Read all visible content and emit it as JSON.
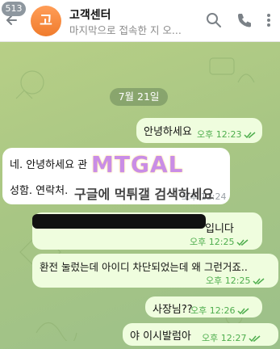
{
  "header": {
    "badge": "513",
    "avatar_letter": "고",
    "title": "고객센터",
    "subtitle": "마지막으로 접속한 지 오...",
    "icons": [
      "back-arrow-icon",
      "search-icon",
      "phone-icon",
      "more-vertical-icon"
    ]
  },
  "date_pill": "7월 21일",
  "messages": [
    {
      "dir": "out",
      "text": "안녕하세요",
      "time": "오후 12:23",
      "read": true
    },
    {
      "dir": "in",
      "text_line1": "네. 안녕하세요 관",
      "text_line2": "성함. 연락처.",
      "time": "오후 12:24"
    },
    {
      "dir": "out",
      "text": "입니다",
      "time": "오후 12:25",
      "read": true,
      "redacted": true
    },
    {
      "dir": "out",
      "text": "환전 눌렀는데 아이디 차단되었는데 왜 그런거죠..",
      "time": "오후 12:25",
      "read": true
    },
    {
      "dir": "out",
      "text": "사장님??",
      "time": "오후 12:26",
      "read": true
    },
    {
      "dir": "out",
      "text": "야 이시발럼아",
      "time": "오후 12:27",
      "read": true
    }
  ],
  "watermark": {
    "logo": "MTGAL",
    "text": "구글에 먹튀갤 검색하세요"
  },
  "colors": {
    "outgoing_bubble": "#effdde",
    "incoming_bubble": "#ffffff",
    "read_check": "#4fae4e",
    "avatar": "#f07c2d"
  }
}
